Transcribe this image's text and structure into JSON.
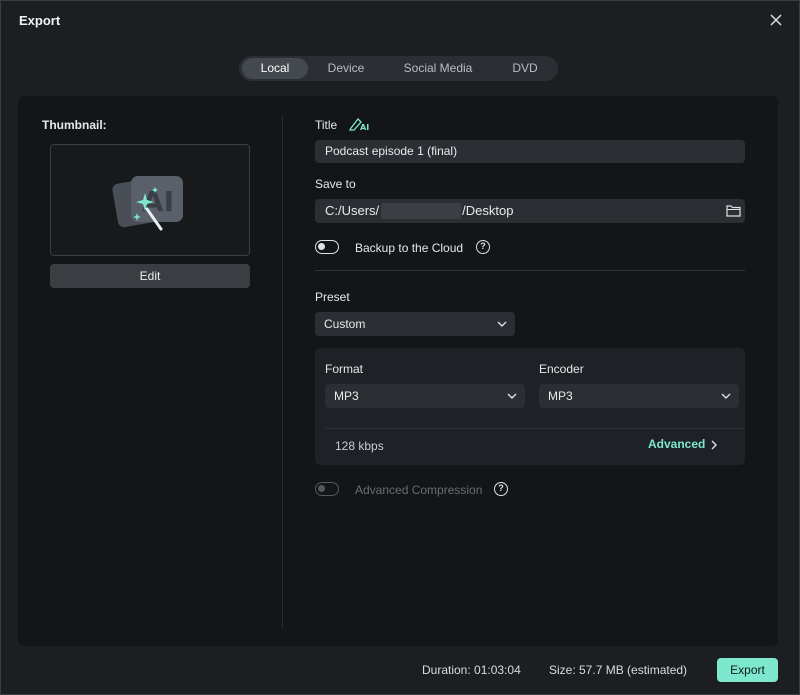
{
  "window": {
    "title": "Export"
  },
  "tabs": [
    {
      "label": "Local",
      "active": true
    },
    {
      "label": "Device",
      "active": false
    },
    {
      "label": "Social Media",
      "active": false
    },
    {
      "label": "DVD",
      "active": false
    }
  ],
  "thumbnail": {
    "label": "Thumbnail:",
    "edit_label": "Edit",
    "icon": "ai-magic-wand-icon"
  },
  "form": {
    "title_label": "Title",
    "title_ai_icon_text": "AI",
    "title_value": "Podcast episode 1 (final)",
    "save_to_label": "Save to",
    "save_to_prefix": "C:/Users/",
    "save_to_suffix": "/Desktop",
    "backup_label": "Backup to the Cloud",
    "backup_on": false,
    "preset_label": "Preset",
    "preset_value": "Custom",
    "format_label": "Format",
    "format_value": "MP3",
    "encoder_label": "Encoder",
    "encoder_value": "MP3",
    "bitrate": "128 kbps",
    "advanced_label": "Advanced",
    "compression_label": "Advanced Compression",
    "compression_on": false,
    "compression_enabled": false
  },
  "footer": {
    "duration": "Duration: 01:03:04",
    "size": "Size:  57.7 MB (estimated)",
    "export_label": "Export"
  },
  "colors": {
    "accent": "#7ee8cf",
    "background": "#1c1e21",
    "panel": "#131516"
  }
}
